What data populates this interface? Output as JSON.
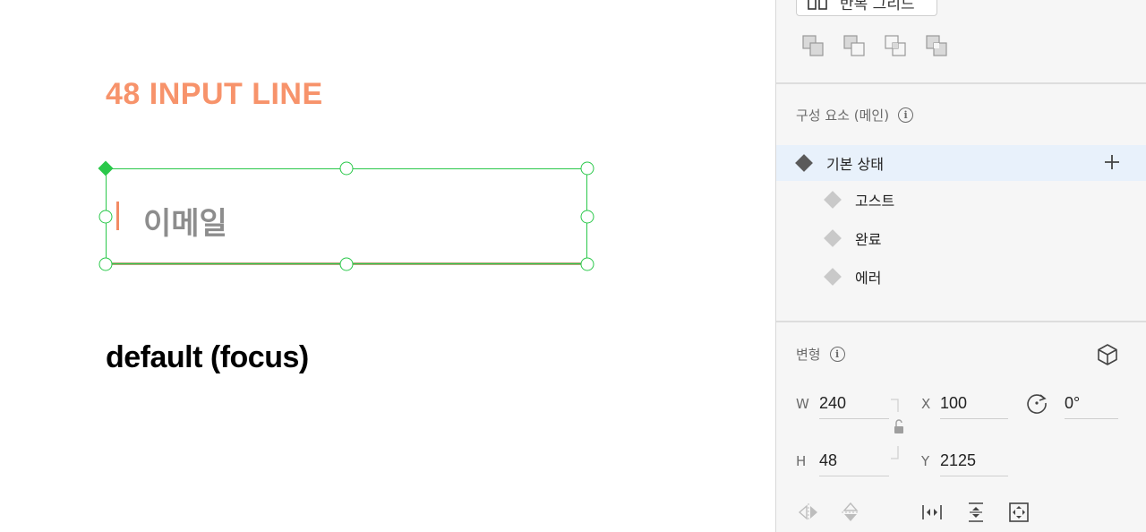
{
  "canvas": {
    "artboard_title": "48 INPUT LINE",
    "input_placeholder": "이메일",
    "state_label": "default (focus)",
    "title_color": "#f7936b",
    "selection_color": "#2ac84a"
  },
  "inspector": {
    "grid_button_label": "반복 그리드",
    "boolean_ops": [
      "add-icon",
      "subtract-icon",
      "intersect-icon",
      "exclude-icon"
    ],
    "components": {
      "title": "구성 요소 (메인)",
      "main_state": "기본 상태",
      "states": [
        "고스트",
        "완료",
        "에러"
      ]
    },
    "transform": {
      "title": "변형",
      "w_label": "W",
      "w_value": "240",
      "h_label": "H",
      "h_value": "48",
      "x_label": "X",
      "x_value": "100",
      "y_label": "Y",
      "y_value": "2125",
      "rotation_value": "0°"
    }
  }
}
